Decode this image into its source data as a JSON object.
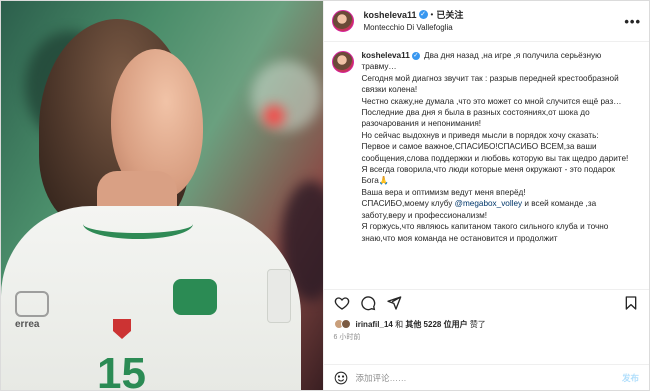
{
  "post": {
    "username": "kosheleva11",
    "follow_status": "已关注",
    "location": "Montecchio Di Vallefoglia",
    "caption_lines": [
      "Два дня назад ,на игре ,я получила серьёзную травму…",
      "Сегодня мой диагноз звучит так : разрыв передней крестообразной связки колена!",
      "Честно скажу,не думала ,что это может со мной случится ещё раз…",
      "Последние два дня я была в разных состояниях,от шока до разочарования и непонимания!",
      "Но сейчас выдохнув и приведя мысли в порядок хочу сказать:",
      "Первое и самое важное,СПАСИБО!СПАСИБО ВСЕМ,за ваши сообщения,слова поддержки и любовь которую вы так щедро дарите!",
      "Я всегда говорила,что люди которые меня окружают - это подарок Бога🙏",
      "Ваша вера и оптимизм ведут меня вперёд!",
      "СПАСИБО,моему клубу",
      "@megabox_volley",
      "и всей команде ,за заботу,веру и профессионализм!",
      "Я горжусь,что являюсь капитаном такого сильного клуба и точно знаю,что моя команда не остановится и продолжит"
    ],
    "likes_user": "irinafil_14",
    "likes_connector": "和",
    "likes_others": "其他 5228 位用户",
    "likes_suffix": "赞了",
    "time_ago": "6 小时前",
    "comment_placeholder": "添加评论……",
    "publish_label": "发布"
  },
  "photo": {
    "jersey_number": "15",
    "brand_text": "errea"
  },
  "icons": {
    "more": "more-horizontal-icon",
    "like": "heart-icon",
    "comment": "comment-icon",
    "share": "share-icon",
    "save": "bookmark-icon",
    "emoji": "emoji-icon"
  },
  "colors": {
    "verified": "#3897f0",
    "mention": "#00376b",
    "publish_disabled": "#b2dffc",
    "jersey_green": "#2b8b54"
  }
}
